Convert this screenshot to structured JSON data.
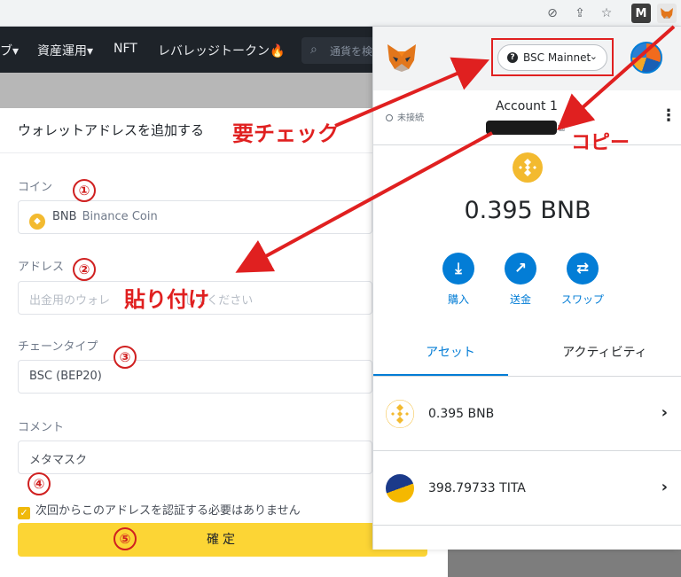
{
  "exchange": {
    "nav_items": [
      "ブ▾",
      "資産運用▾",
      "NFT",
      "レバレッジトークン🔥"
    ],
    "search_placeholder": "通貨を検"
  },
  "form": {
    "title": "ウォレットアドレスを追加する",
    "coin_label": "コイン",
    "coin_symbol": "BNB",
    "coin_name": "Binance Coin",
    "address_label": "アドレス",
    "address_placeholder": "出金用のウォレ",
    "address_placeholder_end": "してください",
    "chain_label": "チェーンタイプ",
    "chain_value": "BSC (BEP20)",
    "comment_label": "コメント",
    "comment_value": "メタマスク",
    "checkbox_label": "次回からこのアドレスを認証する必要はありません",
    "confirm_label": "確定"
  },
  "metamask": {
    "network": "BSC Mainnet",
    "connection_status": "未接続",
    "account_name": "Account 1",
    "balance": "0.395 BNB",
    "actions": [
      "購入",
      "送金",
      "スワップ"
    ],
    "tabs": [
      "アセット",
      "アクティビティ"
    ],
    "assets": [
      {
        "label": "0.395 BNB"
      },
      {
        "label": "398.79733 TITA"
      }
    ]
  },
  "annotations": {
    "check": "要チェック",
    "copy": "コピー",
    "paste": "貼り付け",
    "steps": [
      "①",
      "②",
      "③",
      "④",
      "⑤"
    ]
  },
  "colors": {
    "annotation_red": "#e02020",
    "metamask_blue": "#037dd6",
    "binance_yellow": "#fcd535"
  }
}
